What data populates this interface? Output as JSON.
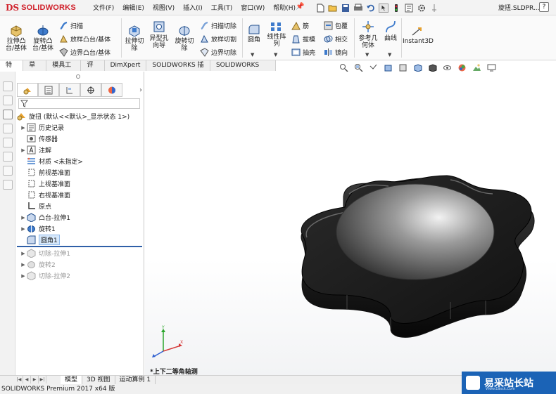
{
  "app": {
    "logo_ds": "DS",
    "logo_text": "SOLIDWORKS",
    "doc_title": "旋扭.SLDPR...",
    "help": "?"
  },
  "menus": [
    "文件(F)",
    "编辑(E)",
    "视图(V)",
    "插入(I)",
    "工具(T)",
    "窗口(W)",
    "帮助(H)"
  ],
  "ribbon": {
    "extrude_boss": "拉伸凸\n台/基体",
    "revolve_boss": "旋转凸\n台/基体",
    "sweep": "扫描",
    "loft_boss": "放样凸台/基体",
    "boundary_boss": "边界凸台/基体",
    "extrude_cut": "拉伸切\n除",
    "hole_wizard": "异型孔\n向导",
    "revolve_cut": "旋转切\n除",
    "sweep_cut": "扫描切除",
    "loft_cut": "放样切割",
    "boundary_cut": "边界切除",
    "fillet": "圆角",
    "linear_pattern": "线性阵\n列",
    "rib": "筋",
    "draft": "拔模",
    "shell": "抽壳",
    "wrap": "包覆",
    "intersect": "相交",
    "mirror": "镜向",
    "ref_geometry": "参考几\n何体",
    "curves": "曲线",
    "instant3d": "Instant3D"
  },
  "tabs": [
    "特征",
    "草图",
    "模具工具",
    "评估",
    "DimXpert",
    "SOLIDWORKS 插件",
    "SOLIDWORKS MBD"
  ],
  "tree": {
    "root": "旋扭 (默认<<默认>_显示状态 1>)",
    "items": [
      {
        "label": "历史记录",
        "icon": "history-icon"
      },
      {
        "label": "传感器",
        "icon": "sensor-icon"
      },
      {
        "label": "注解",
        "icon": "annotation-icon"
      },
      {
        "label": "材质 <未指定>",
        "icon": "material-icon"
      },
      {
        "label": "前视基准面",
        "icon": "plane-icon"
      },
      {
        "label": "上视基准面",
        "icon": "plane-icon"
      },
      {
        "label": "右视基准面",
        "icon": "plane-icon"
      },
      {
        "label": "原点",
        "icon": "origin-icon"
      },
      {
        "label": "凸台-拉伸1",
        "icon": "extrude-icon"
      },
      {
        "label": "旋转1",
        "icon": "revolve-icon"
      },
      {
        "label": "圆角1",
        "icon": "fillet-icon"
      },
      {
        "label": "切除-拉伸1",
        "icon": "cut-extrude-icon"
      },
      {
        "label": "旋转2",
        "icon": "revolve-icon"
      },
      {
        "label": "切除-拉伸2",
        "icon": "cut-extrude-icon"
      }
    ]
  },
  "viewport": {
    "view_label": "*上下二等角轴测"
  },
  "bottom_tabs": [
    "模型",
    "3D 视图",
    "运动算例 1"
  ],
  "status": "SOLIDWORKS Premium 2017 x64 版",
  "watermark": {
    "title": "易采站长站",
    "url": "Www.Easck.Com"
  },
  "colors": {
    "brand": "#d0202a",
    "accent": "#2f5fa8",
    "selection": "#d6e8fb",
    "watermark": "#1b63b6"
  }
}
